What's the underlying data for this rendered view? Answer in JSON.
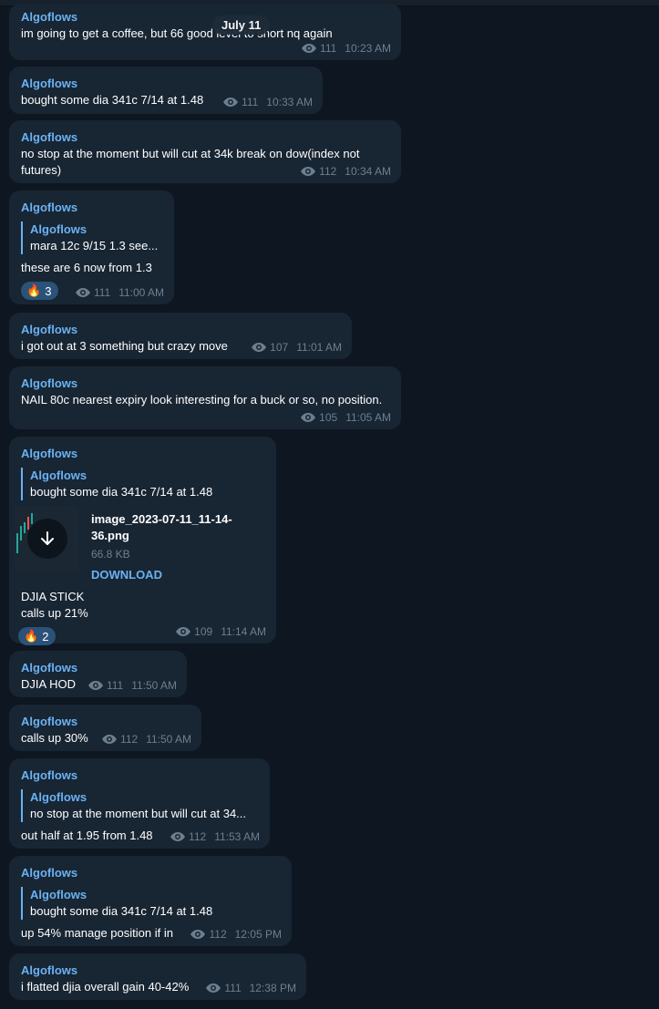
{
  "date_label": "July 11",
  "messages": [
    {
      "author": "Algoflows",
      "text": "im going to get a coffee, but 66 good level to short nq again",
      "views": "111",
      "time": "10:23 AM"
    },
    {
      "author": "Algoflows",
      "text": "bought some dia 341c  7/14 at 1.48",
      "views": "111",
      "time": "10:33 AM"
    },
    {
      "author": "Algoflows",
      "text": "no stop at the moment but will cut at 34k break on dow(index not futures)",
      "views": "112",
      "time": "10:34 AM"
    },
    {
      "author": "Algoflows",
      "reply_author": "Algoflows",
      "reply_text": "mara 12c 9/15 1.3 see...",
      "text": "these are 6 now from 1.3",
      "reaction_count": "3",
      "views": "111",
      "time": "11:00 AM"
    },
    {
      "author": "Algoflows",
      "text": "i got out at 3 something but crazy move",
      "views": "107",
      "time": "11:01 AM"
    },
    {
      "author": "Algoflows",
      "text": "NAIL 80c nearest expiry look interesting for a buck or so, no position.",
      "views": "105",
      "time": "11:05 AM"
    },
    {
      "author": "Algoflows",
      "reply_author": "Algoflows",
      "reply_text": "bought some dia 341c  7/14 at 1.48",
      "file_name": "image_2023-07-11_11-14-36.png",
      "file_size": "66.8 KB",
      "file_action": "DOWNLOAD",
      "text_line1": "DJIA STICK",
      "text_line2": "calls up 21%",
      "reaction_count": "2",
      "views": "109",
      "time": "11:14 AM"
    },
    {
      "author": "Algoflows",
      "text": "DJIA HOD",
      "views": "111",
      "time": "11:50 AM"
    },
    {
      "author": "Algoflows",
      "text": "calls up 30%",
      "views": "112",
      "time": "11:50 AM"
    },
    {
      "author": "Algoflows",
      "reply_author": "Algoflows",
      "reply_text": "no stop at the moment but will cut at 34...",
      "text": "out half at 1.95 from 1.48",
      "views": "112",
      "time": "11:53 AM"
    },
    {
      "author": "Algoflows",
      "reply_author": "Algoflows",
      "reply_text": "bought some dia 341c  7/14 at 1.48",
      "text": "up 54% manage position if in",
      "views": "112",
      "time": "12:05 PM"
    },
    {
      "author": "Algoflows",
      "text": "i flatted djia overall gain 40-42%",
      "views": "111",
      "time": "12:38 PM"
    }
  ],
  "reaction_emoji": "🔥",
  "colors": {
    "background": "#0e1621",
    "bubble": "#182533",
    "accent": "#6ab2f2",
    "meta": "#6d7f8f"
  }
}
